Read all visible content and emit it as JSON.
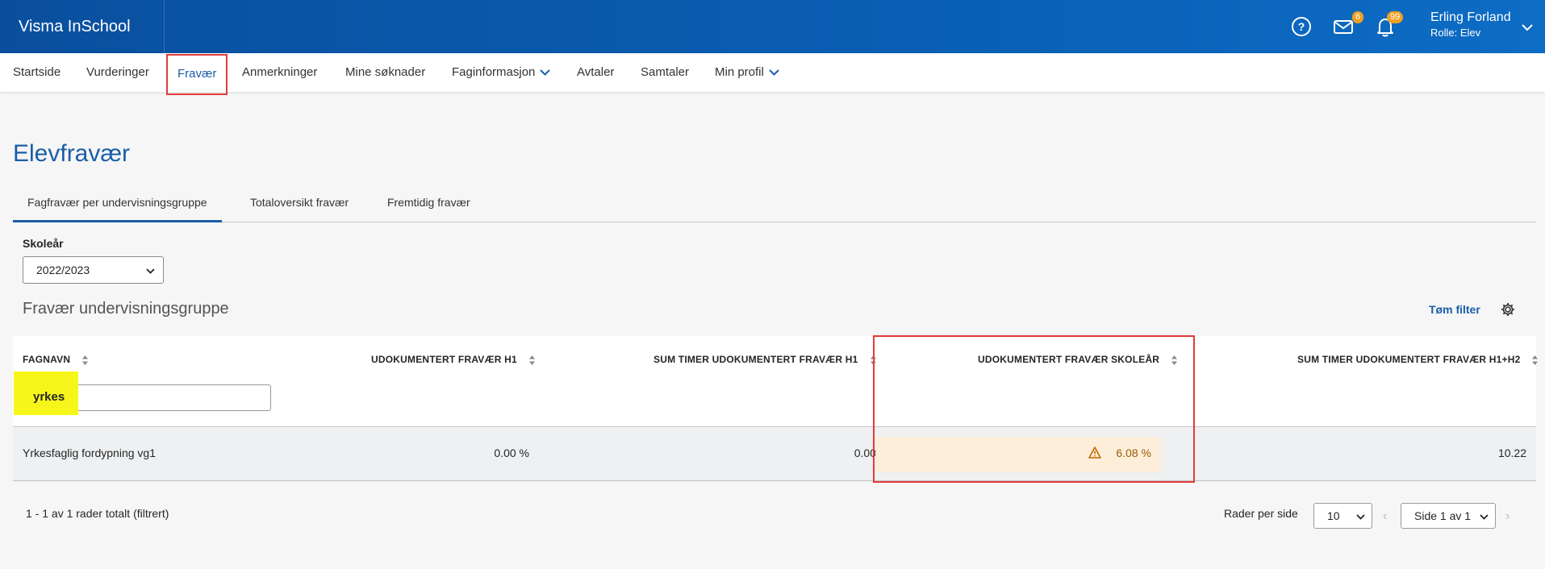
{
  "app": {
    "title": "Visma InSchool"
  },
  "header": {
    "messages_count": "6",
    "notifications_count": "99",
    "user_name": "Erling Forland",
    "user_role": "Rolle: Elev"
  },
  "nav": {
    "items": [
      {
        "label": "Startside"
      },
      {
        "label": "Vurderinger"
      },
      {
        "label": "Fravær"
      },
      {
        "label": "Anmerkninger"
      },
      {
        "label": "Mine søknader"
      },
      {
        "label": "Faginformasjon"
      },
      {
        "label": "Avtaler"
      },
      {
        "label": "Samtaler"
      },
      {
        "label": "Min profil"
      }
    ]
  },
  "page": {
    "title": "Elevfravær"
  },
  "tabs": [
    {
      "label": "Fagfravær per undervisningsgruppe"
    },
    {
      "label": "Totaloversikt fravær"
    },
    {
      "label": "Fremtidig fravær"
    }
  ],
  "filters": {
    "year_label": "Skoleår",
    "year_value": "2022/2023"
  },
  "section": {
    "title": "Fravær undervisningsgruppe",
    "clear_filter": "Tøm filter"
  },
  "table": {
    "columns": [
      "FAGNAVN",
      "UDOKUMENTERT FRAVÆR H1",
      "SUM TIMER UDOKUMENTERT FRAVÆR H1",
      "UDOKUMENTERT FRAVÆR SKOLEÅR",
      "SUM TIMER UDOKUMENTERT FRAVÆR H1+H2"
    ],
    "filter_value": "yrkes",
    "rows": [
      {
        "subject": "Yrkesfaglig fordypning vg1",
        "absence_h1": "0.00 %",
        "hours_h1": "0.00",
        "absence_year": "6.08 %",
        "hours_h1h2": "10.22"
      }
    ]
  },
  "footer": {
    "count_text": "1 - 1 av 1 rader totalt (filtrert)",
    "rows_per_page_label": "Rader per side",
    "rows_per_page": "10",
    "page_text": "Side 1 av 1"
  },
  "colors": {
    "brand": "#0a5fb4",
    "accent": "#1a5ea8",
    "highlight_red": "#e23b3b",
    "warning_bg": "#fdeeda"
  }
}
